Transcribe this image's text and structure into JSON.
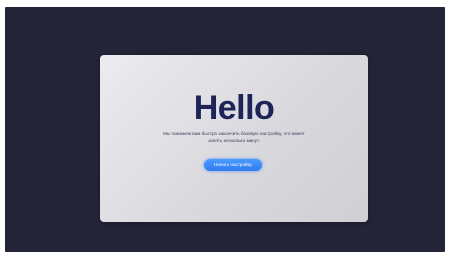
{
  "welcome": {
    "title": "Hello",
    "subtitle": "Мы поможем вам быстро закончить базовую настройку, это может занять несколько минут.",
    "start_button_label": "Начать настройку"
  },
  "colors": {
    "backdrop": "#242438",
    "card": "#dcdce0",
    "title": "#1e2358",
    "button": "#2f7cf0"
  }
}
